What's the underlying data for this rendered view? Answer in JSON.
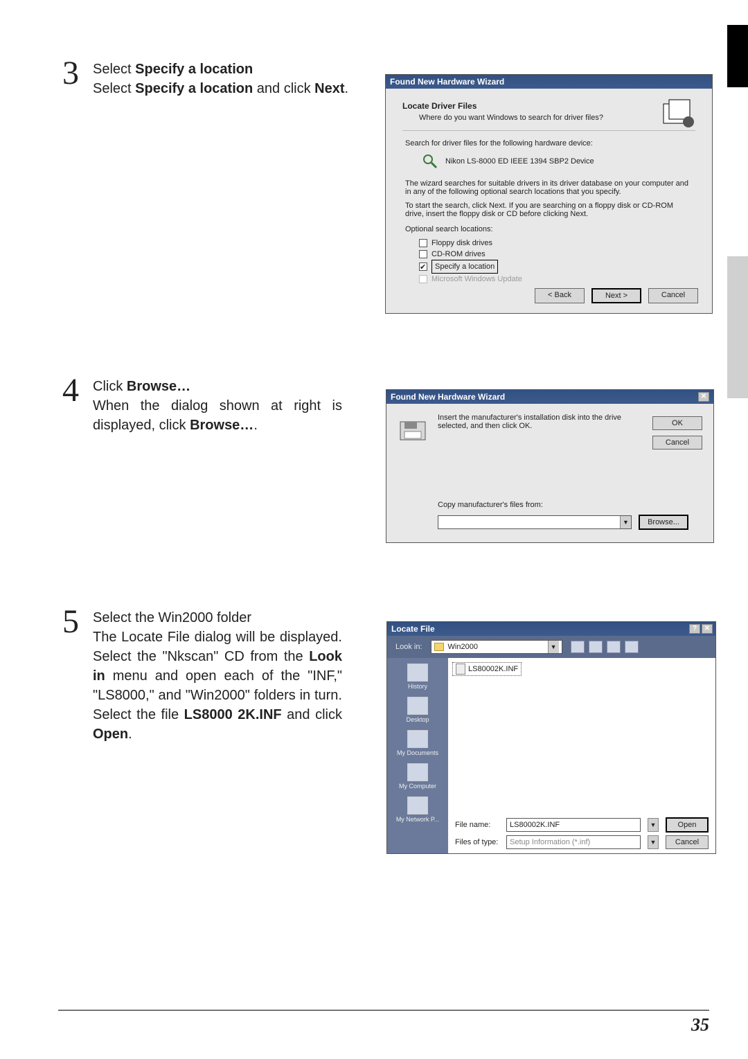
{
  "step3": {
    "num": "3",
    "title_prefix": "Select ",
    "title_bold": "Specify a location",
    "body_prefix": "Select ",
    "body_bold": "Specify a location",
    "body_mid": " and click ",
    "body_bold2": "Next",
    "body_suffix": "."
  },
  "dlg1": {
    "title": "Found New Hardware Wizard",
    "subtitle": "Locate Driver Files",
    "question": "Where do you want Windows to search for driver files?",
    "search_line": "Search for driver files for the following hardware device:",
    "device": "Nikon   LS-8000 ED      IEEE 1394 SBP2 Device",
    "para1": "The wizard searches for suitable drivers in its driver database on your computer and in any of the following optional search locations that you specify.",
    "para2": "To start the search, click Next. If you are searching on a floppy disk or CD-ROM drive, insert the floppy disk or CD before clicking Next.",
    "opt_label": "Optional search locations:",
    "opts": [
      {
        "label": "Floppy disk drives",
        "checked": false,
        "gray": false
      },
      {
        "label": "CD-ROM drives",
        "checked": false,
        "gray": false
      },
      {
        "label": "Specify a location",
        "checked": true,
        "gray": false,
        "highlight": true
      },
      {
        "label": "Microsoft Windows Update",
        "checked": false,
        "gray": true
      }
    ],
    "back": "< Back",
    "next": "Next >",
    "cancel": "Cancel"
  },
  "step4": {
    "num": "4",
    "title_prefix": "Click ",
    "title_bold": "Browse…",
    "body_prefix": "When the dialog shown at right is displayed, click ",
    "body_bold": "Browse…",
    "body_suffix": "."
  },
  "dlg2": {
    "title": "Found New Hardware Wizard",
    "msg": "Insert the manufacturer's installation disk into the drive selected, and then click OK.",
    "ok": "OK",
    "cancel": "Cancel",
    "copy_label": "Copy manufacturer's files from:",
    "browse": "Browse..."
  },
  "step5": {
    "num": "5",
    "title": "Select the Win2000 folder",
    "body_1": "The Locate File dialog will be displayed. Select the \"Nkscan\" CD from the ",
    "body_b1": "Look in",
    "body_2": " menu and open each of the \"INF,\" \"LS8000,\" and \"Win2000\" folders in turn.  Select the file ",
    "body_b2": "LS8000 2K.INF",
    "body_3": " and click ",
    "body_b3": "Open",
    "body_4": "."
  },
  "dlg3": {
    "title": "Locate File",
    "lookin_label": "Look in:",
    "lookin_value": "Win2000",
    "file_item": "LS80002K.INF",
    "places": [
      "History",
      "Desktop",
      "My Documents",
      "My Computer",
      "My Network P..."
    ],
    "filename_label": "File name:",
    "filename_value": "LS80002K.INF",
    "filetype_label": "Files of type:",
    "filetype_value": "Setup Information (*.inf)",
    "open": "Open",
    "cancel": "Cancel"
  },
  "page_number": "35"
}
